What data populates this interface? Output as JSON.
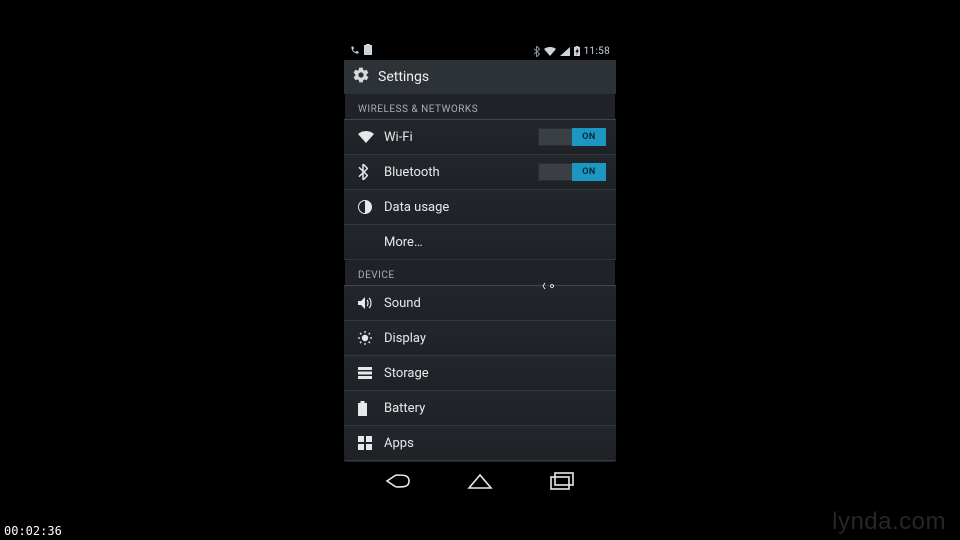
{
  "status_bar": {
    "clock": "11:58"
  },
  "app_bar": {
    "title": "Settings"
  },
  "sections": {
    "wireless": {
      "header": "WIRELESS & NETWORKS",
      "wifi": {
        "label": "Wi-Fi",
        "toggle": "ON"
      },
      "bluetooth": {
        "label": "Bluetooth",
        "toggle": "ON"
      },
      "data_usage": {
        "label": "Data usage"
      },
      "more": {
        "label": "More…"
      }
    },
    "device": {
      "header": "DEVICE",
      "sound": {
        "label": "Sound"
      },
      "display": {
        "label": "Display"
      },
      "storage": {
        "label": "Storage"
      },
      "battery": {
        "label": "Battery"
      },
      "apps": {
        "label": "Apps"
      }
    }
  },
  "overlay": {
    "timestamp": "00:02:36",
    "watermark": "lynda.com"
  }
}
